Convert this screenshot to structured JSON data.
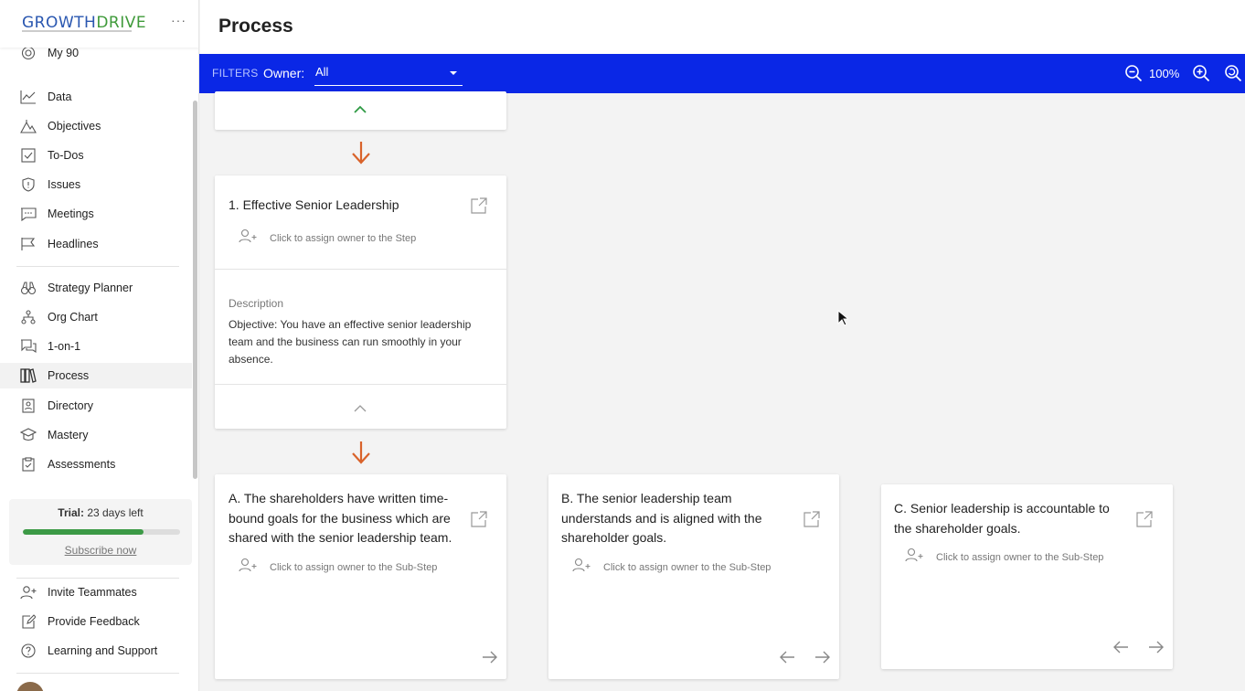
{
  "sidebar": {
    "logo_growth": "GROWTH",
    "logo_drive": "DRIVE",
    "more_label": "···",
    "items": [
      {
        "label": "My 90",
        "icon": "target-icon"
      },
      {
        "label": "Data",
        "icon": "line-chart-icon"
      },
      {
        "label": "Objectives",
        "icon": "mountain-icon"
      },
      {
        "label": "To-Dos",
        "icon": "checkbox-icon"
      },
      {
        "label": "Issues",
        "icon": "shield-alert-icon"
      },
      {
        "label": "Meetings",
        "icon": "chat-icon"
      },
      {
        "label": "Headlines",
        "icon": "flag-icon"
      },
      {
        "label": "Strategy Planner",
        "icon": "binoculars-icon"
      },
      {
        "label": "Org Chart",
        "icon": "org-chart-icon"
      },
      {
        "label": "1-on-1",
        "icon": "conversation-icon"
      },
      {
        "label": "Process",
        "icon": "books-icon"
      },
      {
        "label": "Directory",
        "icon": "contact-book-icon"
      },
      {
        "label": "Mastery",
        "icon": "graduation-cap-icon"
      },
      {
        "label": "Assessments",
        "icon": "clipboard-icon"
      }
    ],
    "trial": {
      "label": "Trial:",
      "value": "23 days left",
      "progress": 0.77,
      "subscribe": "Subscribe now"
    },
    "bottom_items": [
      {
        "label": "Invite Teammates",
        "icon": "add-user-icon"
      },
      {
        "label": "Provide Feedback",
        "icon": "edit-icon"
      },
      {
        "label": "Learning and Support",
        "icon": "help-icon"
      }
    ]
  },
  "header": {
    "title": "Process"
  },
  "filters": {
    "label": "FILTERS",
    "owner_label": "Owner:",
    "owner_value": "All",
    "zoom": "100%"
  },
  "step": {
    "title": "1. Effective Senior Leadership",
    "assign_text": "Click to assign owner to the Step",
    "description_label": "Description",
    "description": "Objective: You have an effective senior leadership team and the business can run smoothly in your absence."
  },
  "substeps": [
    {
      "title": "A. The shareholders have written time-bound goals for the business which are shared with the senior leadership team.",
      "assign_text": "Click to assign owner to the Sub-Step"
    },
    {
      "title": "B. The senior leadership team understands and is aligned with the shareholder goals.",
      "assign_text": "Click to assign owner to the Sub-Step"
    },
    {
      "title": "C. Senior leadership is accountable to the shareholder goals.",
      "assign_text": "Click to assign owner to the Sub-Step"
    }
  ],
  "colors": {
    "filterbar": "#0a27e6",
    "arrow": "#d9632b",
    "collapse_green": "#2e9a44",
    "trial_green": "#3c9a46"
  }
}
